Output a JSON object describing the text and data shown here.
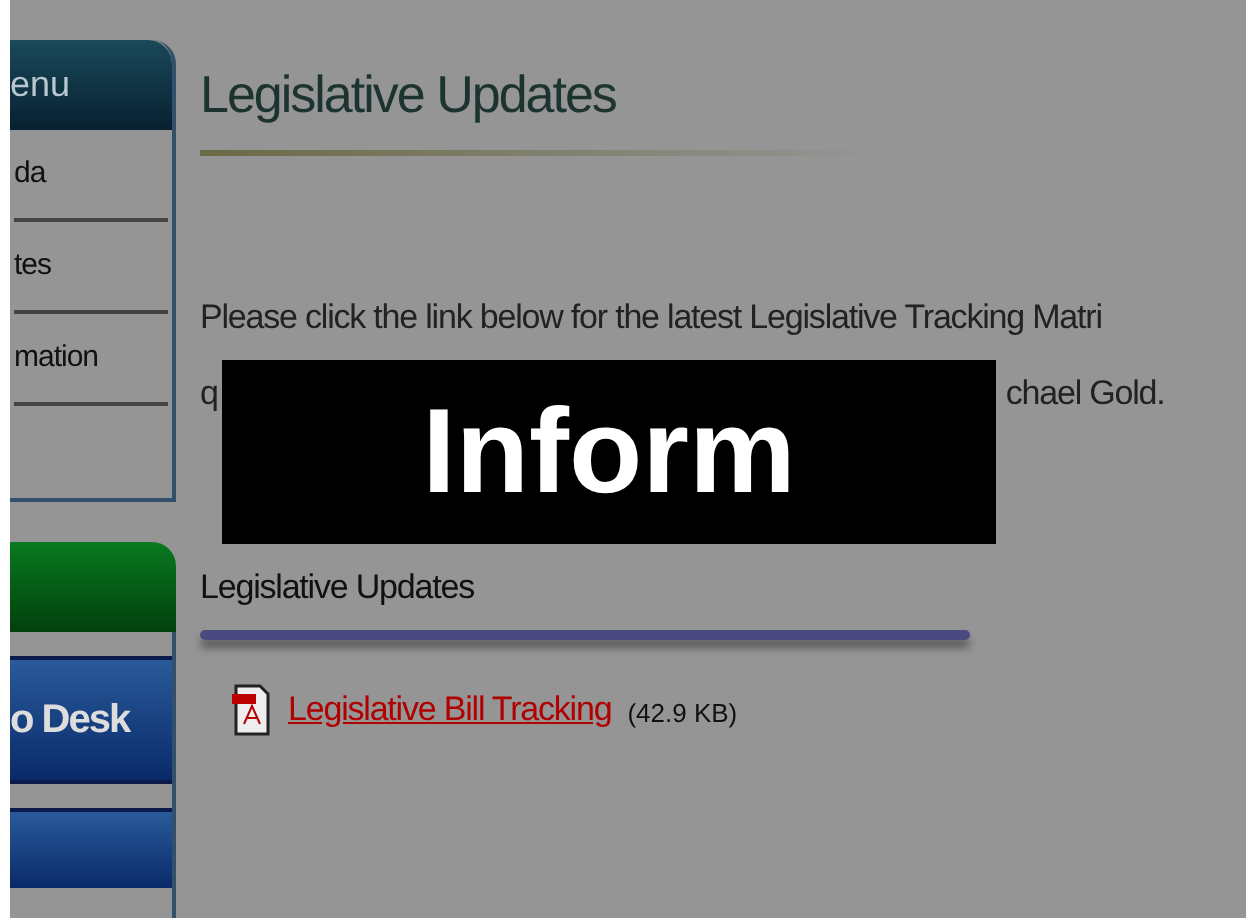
{
  "sidebar": {
    "menu_title": "enu",
    "items": [
      {
        "label": "da"
      },
      {
        "label": "tes"
      },
      {
        "label": "mation"
      }
    ],
    "buttons": [
      {
        "label": "o Desk"
      }
    ]
  },
  "main": {
    "title": "Legislative Updates",
    "paragraph_line_1": "Please click the link below for the latest Legislative Tracking Matri",
    "paragraph_line_2_start": "q",
    "paragraph_line_2_end": "chael Gold.",
    "section_title": "Legislative Updates",
    "file_link": {
      "label": "Legislative Bill Tracking",
      "size": "(42.9 KB)"
    }
  },
  "overlay": {
    "text": "Inform"
  }
}
